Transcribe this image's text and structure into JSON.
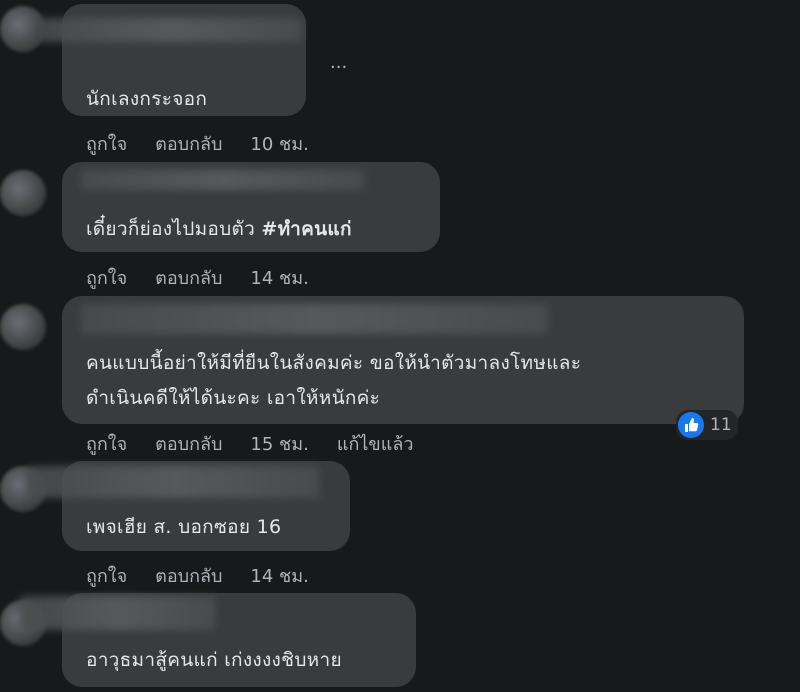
{
  "comments": [
    {
      "text": "นักเลงกระจอก",
      "actions": {
        "like": "ถูกใจ",
        "reply": "ตอบกลับ",
        "time": "10 ชม."
      },
      "extra": "..."
    },
    {
      "text": "เดี๋ยวก็ย่องไปมอบตัว ",
      "hashtag": "#ทำคนแก่",
      "actions": {
        "like": "ถูกใจ",
        "reply": "ตอบกลับ",
        "time": "14 ชม."
      }
    },
    {
      "line1": "คนแบบนี้อย่าให้มีที่ยืนในสังคมค่ะ ขอให้นำตัวมาลงโทษและ",
      "line2": "ดำเนินคดีให้ได้นะคะ เอาให้หนักค่ะ",
      "actions": {
        "like": "ถูกใจ",
        "reply": "ตอบกลับ",
        "time": "15 ชม.",
        "edited": "แก้ไขแล้ว"
      },
      "reaction": {
        "icon": "thumbs-up-icon",
        "count": "11"
      }
    },
    {
      "text": "เพจเฮีย ส. บอกซอย 16",
      "actions": {
        "like": "ถูกใจ",
        "reply": "ตอบกลับ",
        "time": "14 ชม."
      }
    },
    {
      "text": "อาวุธมาสู้คนแก่ เก่งงงงชิบหาย"
    }
  ],
  "colors": {
    "background": "#18191a",
    "bubble": "#3a3b3c",
    "meta": "#b0b3b8",
    "like": "#1877f2"
  }
}
